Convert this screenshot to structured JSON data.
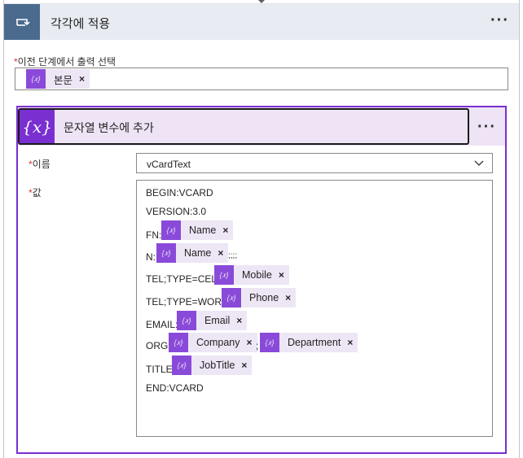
{
  "header": {
    "title": "각각에 적용",
    "more": "···"
  },
  "loop_field": {
    "required_mark": "*",
    "label": "이전 단계에서 출력 선택",
    "token": {
      "label": "본문",
      "remove": "×"
    }
  },
  "action": {
    "icon_text": "{x}",
    "title": "문자열 변수에 추가",
    "more": "···",
    "name_field": {
      "required_mark": "*",
      "label": "이름",
      "value": "vCardText"
    },
    "value_field": {
      "required_mark": "*",
      "label": "값",
      "lines": {
        "begin": "BEGIN:VCARD",
        "version": "VERSION:3.0",
        "fn_prefix": "FN:",
        "fn_token": "Name",
        "n_prefix": "N:",
        "n_token": "Name",
        "n_suffix": ";;;;",
        "tel_cell_prefix": "TEL;TYPE=CELL:",
        "tel_cell_token": "Mobile",
        "tel_work_prefix": "TEL;TYPE=WORK:",
        "tel_work_token": "Phone",
        "email_prefix": "EMAIL:",
        "email_token": "Email",
        "org_prefix": "ORG:",
        "org_token_1": "Company",
        "org_sep": ";",
        "org_token_2": "Department",
        "title_prefix": "TITLE:",
        "title_token": "JobTitle",
        "end": "END:VCARD"
      },
      "remove": "×"
    }
  },
  "colors": {
    "header_bg": "#e8ecf2",
    "header_icon_bg": "#4a6a8e",
    "action_accent": "#7a2fd1",
    "token_bg": "#ede6f5",
    "token_icon_bg": "#8a4ad9"
  },
  "icons": {
    "loop": "loop-icon",
    "variable": "variable-icon",
    "token": "expression-token-icon",
    "dropdown": "chevron-down-icon"
  }
}
